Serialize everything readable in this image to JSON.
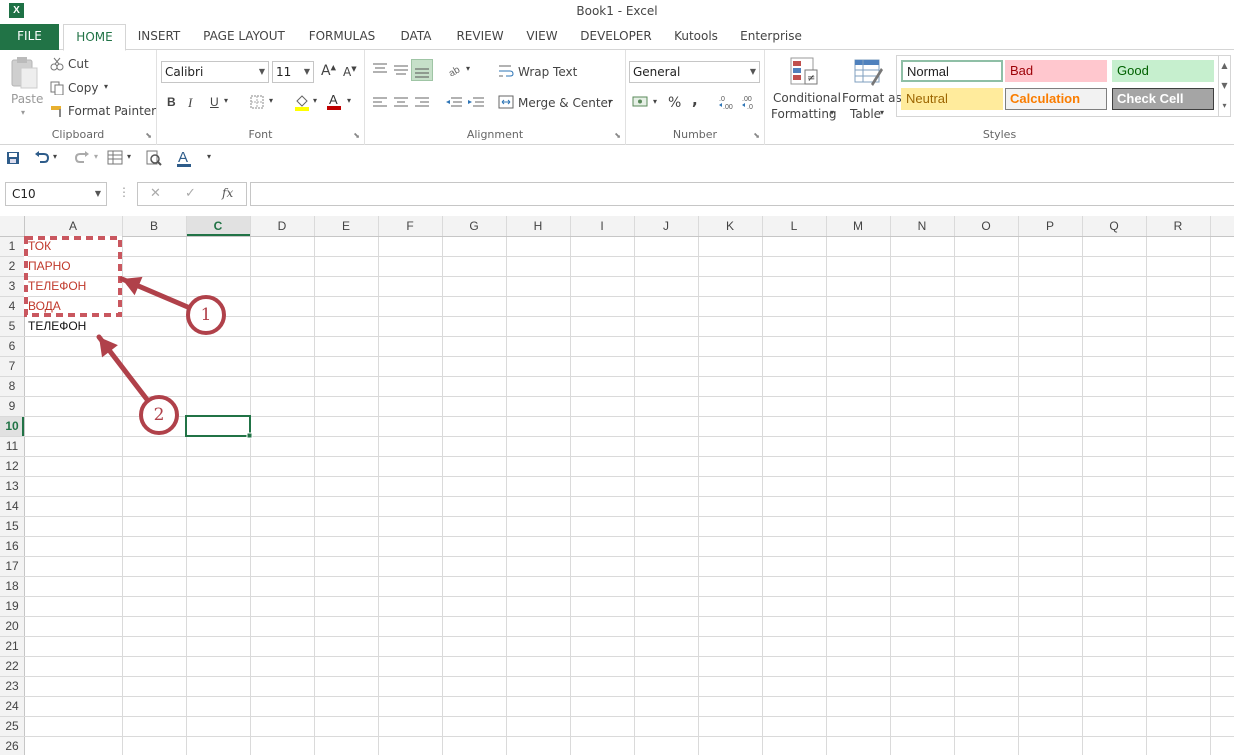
{
  "window": {
    "title": "Book1 - Excel",
    "app_icon": "X"
  },
  "tabs": [
    "FILE",
    "HOME",
    "INSERT",
    "PAGE LAYOUT",
    "FORMULAS",
    "DATA",
    "REVIEW",
    "VIEW",
    "DEVELOPER",
    "Kutools",
    "Enterprise"
  ],
  "ribbon": {
    "clipboard": {
      "label": "Clipboard",
      "paste": "Paste",
      "cut": "Cut",
      "copy": "Copy",
      "format_painter": "Format Painter"
    },
    "font": {
      "label": "Font",
      "font_name": "Calibri",
      "font_size": "11",
      "bold": "B",
      "italic": "I",
      "underline": "U",
      "font_color": "#c00000",
      "fill_color": "#ffff00"
    },
    "alignment": {
      "label": "Alignment",
      "wrap_text": "Wrap Text",
      "merge_center": "Merge & Center"
    },
    "number": {
      "label": "Number",
      "format": "General",
      "percent": "%",
      "comma": ","
    },
    "styles": {
      "label": "Styles",
      "conditional_formatting_1": "Conditional",
      "conditional_formatting_2": "Formatting",
      "format_as_table_1": "Format as",
      "format_as_table_2": "Table",
      "cell_styles": [
        {
          "name": "Normal",
          "bg": "#ffffff",
          "fg": "#222222",
          "border": "#8fbfa6"
        },
        {
          "name": "Bad",
          "bg": "#ffc7ce",
          "fg": "#9c0006",
          "border": "#ffc7ce"
        },
        {
          "name": "Good",
          "bg": "#c6efce",
          "fg": "#006100",
          "border": "#c6efce"
        },
        {
          "name": "Neutral",
          "bg": "#ffeb9c",
          "fg": "#9c6500",
          "border": "#ffeb9c"
        },
        {
          "name": "Calculation",
          "bg": "#f2f2f2",
          "fg": "#fa7d00",
          "border": "#7f7f7f"
        },
        {
          "name": "Check Cell",
          "bg": "#a5a5a5",
          "fg": "#ffffff",
          "border": "#3f3f3f"
        }
      ]
    }
  },
  "formula_bar": {
    "name_box": "C10",
    "fx": "fx",
    "value": ""
  },
  "sheet": {
    "columns": [
      "A",
      "B",
      "C",
      "D",
      "E",
      "F",
      "G",
      "H",
      "I",
      "J",
      "K",
      "L",
      "M",
      "N",
      "O",
      "P",
      "Q",
      "R"
    ],
    "active_column": "C",
    "active_row": 10,
    "row_count": 26,
    "cells": [
      {
        "ref": "A1",
        "value": "ТОК",
        "style": "red"
      },
      {
        "ref": "A2",
        "value": "ПАРНО",
        "style": "red"
      },
      {
        "ref": "A3",
        "value": "ТЕЛЕФОН",
        "style": "red"
      },
      {
        "ref": "A4",
        "value": "ВОДА",
        "style": "red"
      },
      {
        "ref": "A5",
        "value": "ТЕЛЕФОН",
        "style": "black"
      }
    ],
    "callouts": [
      "1",
      "2"
    ],
    "accent_color": "#217346",
    "callout_color": "#b0414a"
  }
}
